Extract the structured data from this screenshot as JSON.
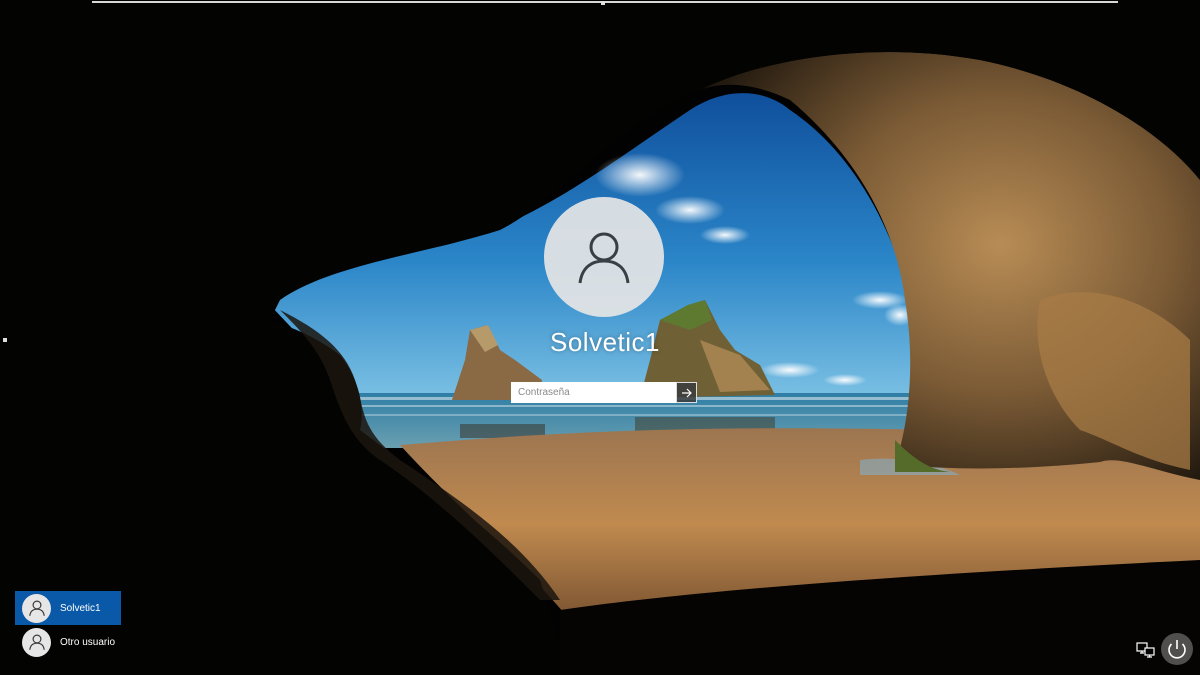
{
  "login": {
    "username": "Solvetic1",
    "password_placeholder": "Contraseña"
  },
  "user_list": [
    {
      "name": "Solvetic1",
      "selected": true
    },
    {
      "name": "Otro usuario",
      "selected": false
    }
  ],
  "tray": {
    "network_icon": "network-icon",
    "power_icon": "power-icon"
  },
  "colors": {
    "selected_user_bg": "#0a58a8",
    "avatar_bg": "#e6e6e6",
    "sky": "#2f86c6",
    "sand": "#b9834a"
  }
}
